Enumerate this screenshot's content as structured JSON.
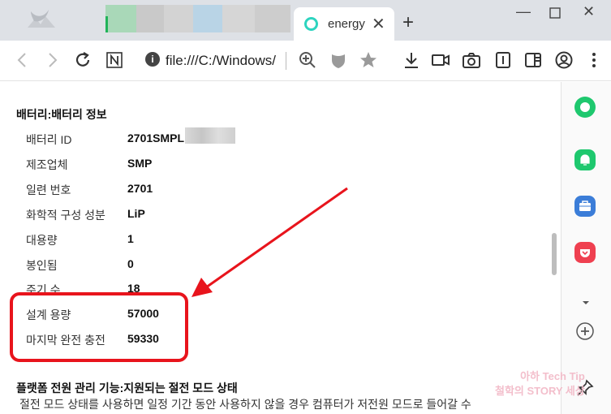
{
  "browser": {
    "active_tab_title": "energy",
    "address": "file:///C:/Windows/"
  },
  "battery_section": {
    "title": "배터리:배터리 정보",
    "rows": [
      {
        "label": "배터리 ID",
        "value": "2701SMPL"
      },
      {
        "label": "제조업체",
        "value": "SMP"
      },
      {
        "label": "일련 번호",
        "value": "2701"
      },
      {
        "label": "화학적 구성 성분",
        "value": "LiP"
      },
      {
        "label": "대용량",
        "value": "1"
      },
      {
        "label": "봉인됨",
        "value": "0"
      },
      {
        "label": "주기 수",
        "value": "18"
      },
      {
        "label": "설계 용량",
        "value": "57000"
      },
      {
        "label": "마지막 완전 충전",
        "value": "59330"
      }
    ]
  },
  "power_section": {
    "title": "플랫폼 전원 관리 기능:지원되는 절전 모드 상태",
    "description": "절전 모드 상태를 사용하면 일정 기간 동안 사용하지 않을 경우 컴퓨터가 저전원 모드로 들어갈 수"
  },
  "watermark": {
    "line1": "아하 Tech Tip",
    "line2": "철학의 STORY 세상"
  },
  "colors": {
    "highlight": "#e8141c",
    "sidebar_green": "#1ec86e",
    "sidebar_blue": "#3b7dd8",
    "sidebar_red": "#ef4050"
  }
}
